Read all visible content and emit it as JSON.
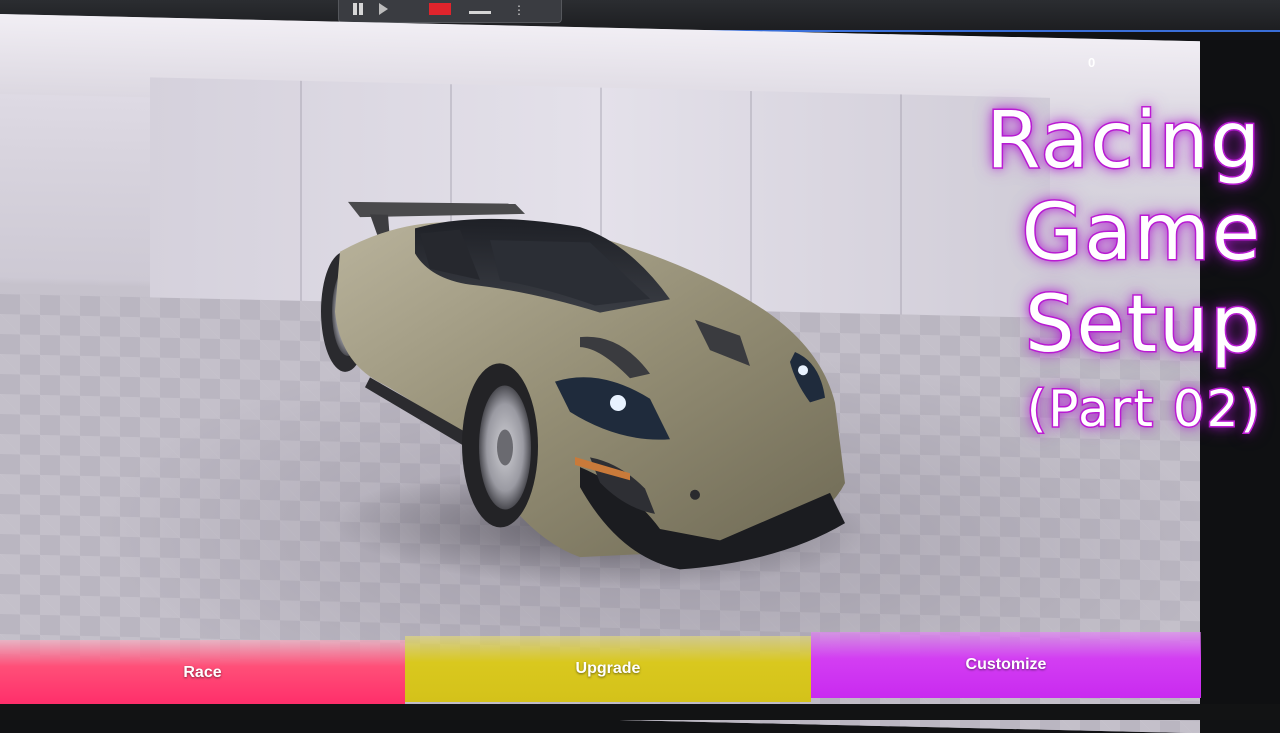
{
  "toolbar": {
    "buttons": [
      "pause-icon",
      "step-icon",
      "stop-icon",
      "eject-icon",
      "more-icon"
    ],
    "more_label": "⋮"
  },
  "hud": {
    "counter": "0"
  },
  "title": {
    "line1": "Racing",
    "line2": "Game",
    "line3": "Setup",
    "sub": "(Part 02)"
  },
  "menu": {
    "race_label": "Race",
    "upgrade_label": "Upgrade",
    "customize_label": "Customize"
  },
  "colors": {
    "race": "#ff2d6a",
    "upgrade": "#d4c21a",
    "customize": "#c92af0",
    "title_glow": "#c41fd6",
    "toolbar_accent": "#3a6fd8"
  }
}
